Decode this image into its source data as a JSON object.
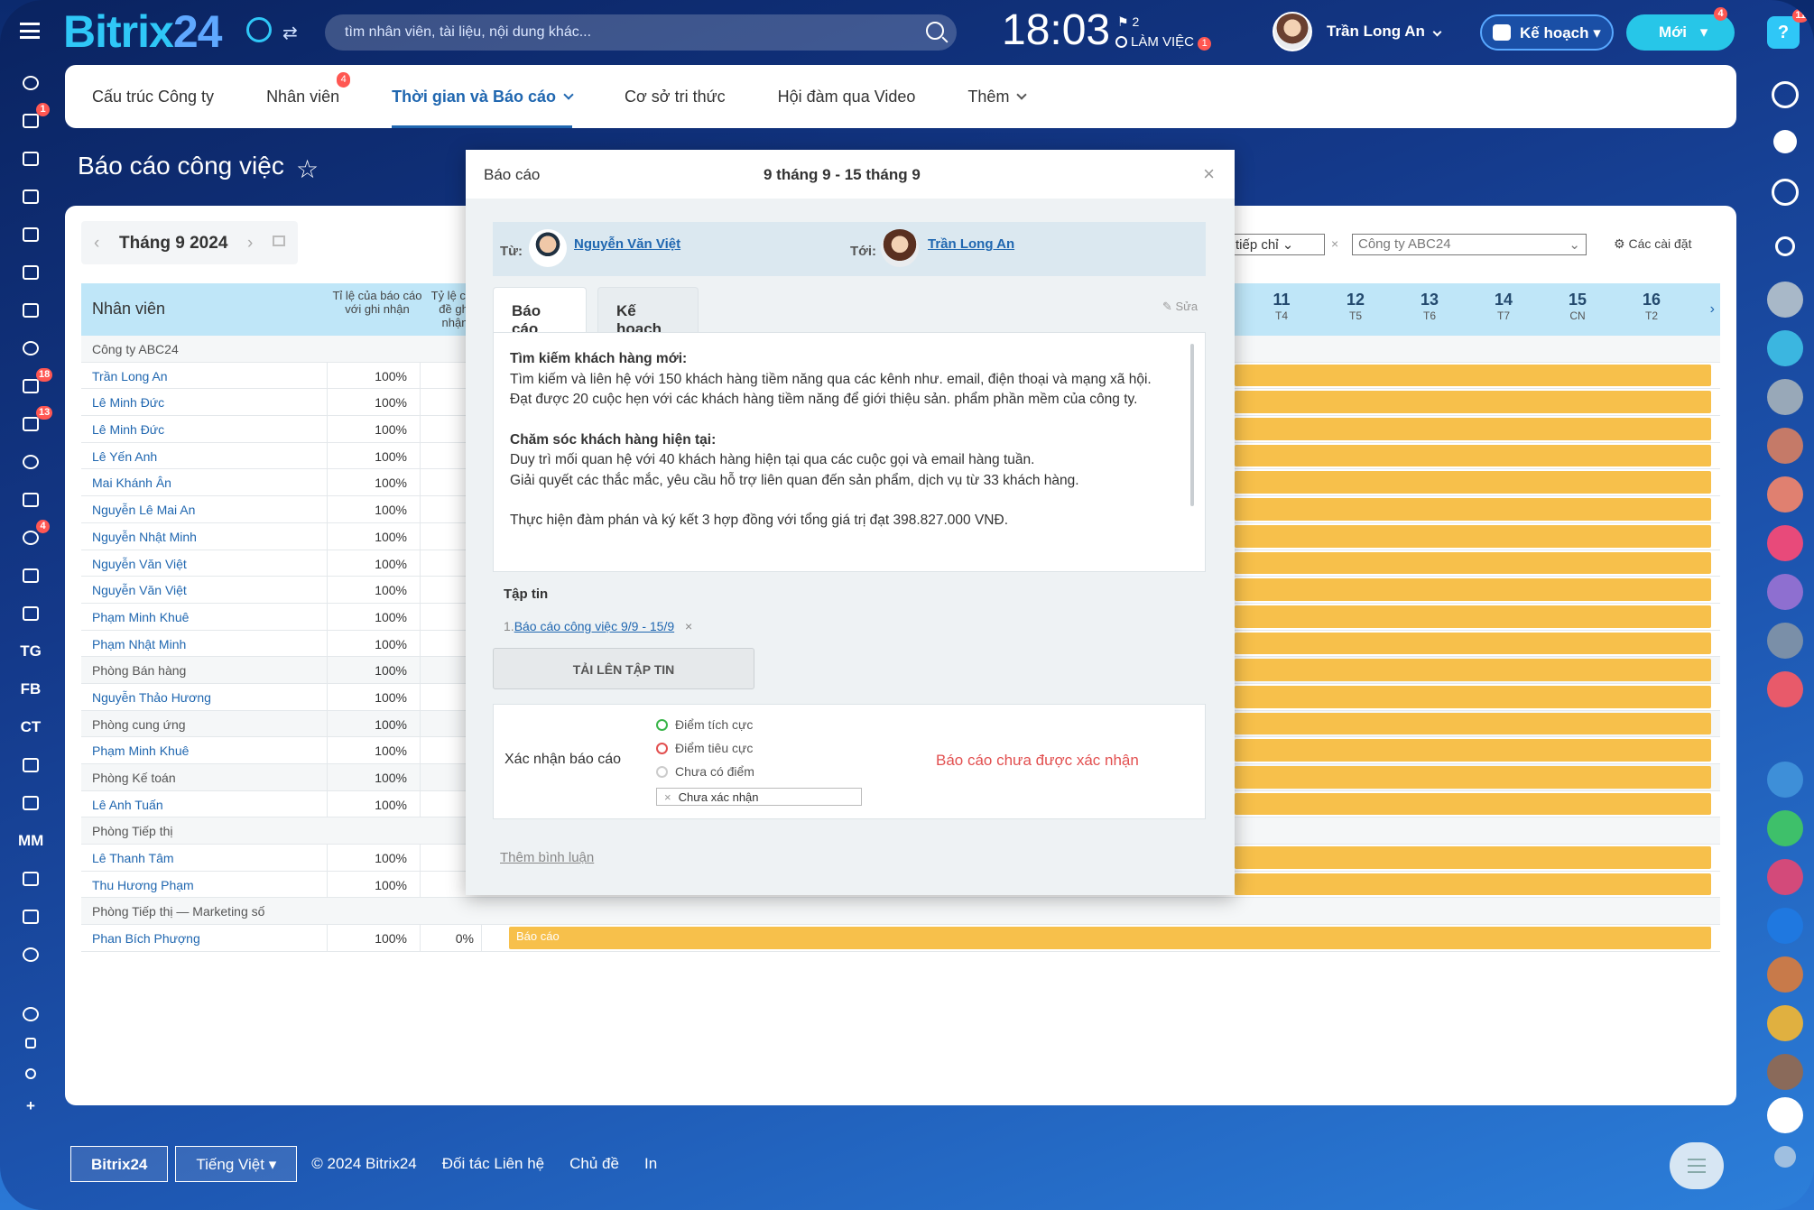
{
  "topbar": {
    "logo_a": "Bitrix",
    "logo_b": "24",
    "search_placeholder": "tìm nhân viên, tài liệu, nội dung khác...",
    "time": "18:03",
    "flag_count": "2",
    "work_status": "LÀM VIỆC",
    "work_badge": "1",
    "user_name": "Trần Long An",
    "plan_label": "Kế hoạch",
    "new_label": "Mới",
    "new_badge": "4",
    "help_badge": "11"
  },
  "left_rail": {
    "badges": {
      "tasks": "1",
      "todo": "18",
      "filter": "13",
      "contacts": "4"
    },
    "text_items": [
      "TG",
      "FB",
      "CT",
      "MM"
    ]
  },
  "nav": {
    "items": [
      {
        "label": "Cấu trúc Công ty"
      },
      {
        "label": "Nhân viên",
        "badge": "4"
      },
      {
        "label": "Thời gian và Báo cáo",
        "active": true
      },
      {
        "label": "Cơ sở tri thức"
      },
      {
        "label": "Hội đàm qua Video"
      },
      {
        "label": "Thêm"
      }
    ]
  },
  "page": {
    "title": "Báo cáo công việc",
    "month": "Tháng 9 2024"
  },
  "filters": {
    "f1": "tiếp chỉ",
    "f2": "Công ty ABC24",
    "settings": "Các cài đặt"
  },
  "grid": {
    "col_name": "Nhân viên",
    "col_ratio": "Tỉ lệ của báo cáo với ghi nhận",
    "col_ratio2": "Tỷ lệ chủ đề ghi nhận",
    "days": [
      {
        "d": "11",
        "w": "T4"
      },
      {
        "d": "12",
        "w": "T5"
      },
      {
        "d": "13",
        "w": "T6"
      },
      {
        "d": "14",
        "w": "T7"
      },
      {
        "d": "15",
        "w": "CN"
      },
      {
        "d": "16",
        "w": "T2"
      }
    ],
    "rows": [
      {
        "name": "Công ty ABC24",
        "group": true
      },
      {
        "name": "Trần Long An",
        "pct": "100%",
        "bar": true
      },
      {
        "name": "Lê Minh Đức",
        "pct": "100%",
        "bar": true
      },
      {
        "name": "Lê Minh Đức",
        "pct": "100%",
        "bar": true
      },
      {
        "name": "Lê Yến Anh",
        "pct": "100%",
        "bar": true
      },
      {
        "name": "Mai Khánh Ân",
        "pct": "100%",
        "bar": true
      },
      {
        "name": "Nguyễn Lê Mai An",
        "pct": "100%",
        "bar": true
      },
      {
        "name": "Nguyễn Nhật Minh",
        "pct": "100%",
        "bar": true
      },
      {
        "name": "Nguyễn Văn Việt",
        "pct": "100%",
        "bar": true
      },
      {
        "name": "Nguyễn Văn Việt",
        "pct": "100%",
        "bar": true
      },
      {
        "name": "Phạm Minh Khuê",
        "pct": "100%",
        "bar": true
      },
      {
        "name": "Phạm Nhật Minh",
        "pct": "100%",
        "bar": true
      },
      {
        "name": "Phòng Bán hàng",
        "group": true,
        "pct": "100%",
        "bar": true
      },
      {
        "name": "Nguyễn Thảo Hương",
        "pct": "100%",
        "bar": true
      },
      {
        "name": "Phòng cung ứng",
        "group": true,
        "pct": "100%",
        "bar": true
      },
      {
        "name": "Phạm Minh Khuê",
        "pct": "100%",
        "bar": true
      },
      {
        "name": "Phòng Kế toán",
        "group": true,
        "pct": "100%",
        "bar": true
      },
      {
        "name": "Lê Anh Tuấn",
        "pct": "100%",
        "bar": true
      },
      {
        "name": "Phòng Tiếp thị",
        "group": true
      },
      {
        "name": "Lê Thanh Tâm",
        "pct": "100%",
        "bar": true
      },
      {
        "name": "Thu Hương Phạm",
        "pct": "100%",
        "bar": true
      },
      {
        "name": "Phòng Tiếp thị — Marketing số",
        "group": true
      },
      {
        "name": "Phan Bích Phượng",
        "pct": "100%",
        "pct2": "0%",
        "bar": true,
        "full": true,
        "bar_label": "Báo cáo"
      }
    ]
  },
  "modal": {
    "title": "Báo cáo",
    "dates": "9 tháng 9 - 15 tháng 9",
    "from_label": "Từ:",
    "from_name": "Nguyễn Văn Việt",
    "to_label": "Tới:",
    "to_name": "Trần Long An",
    "tab_report": "Báo cáo",
    "tab_plan": "Kế hoạch",
    "edit": "Sửa",
    "content": {
      "h1": "Tìm kiếm khách hàng mới:",
      "p1": "Tìm kiếm và liên hệ với 150 khách hàng tiềm năng qua các kênh như. email, điện thoại và mạng xã hội.",
      "p2": "Đạt được 20 cuộc hẹn với các khách hàng tiềm năng để giới thiệu sản. phẩm phần mềm của công ty.",
      "h2": "Chăm sóc khách hàng hiện tại:",
      "p3": "Duy trì mối quan hệ với 40 khách hàng hiện tại qua các cuộc gọi và email hàng tuần.",
      "p4": "Giải quyết các thắc mắc, yêu cầu hỗ trợ liên quan đến sản phẩm, dịch vụ từ 33 khách hàng.",
      "p5": "Thực hiện đàm phán và ký kết 3 hợp đồng với tổng giá trị đạt 398.827.000 VNĐ."
    },
    "files_title": "Tập tin",
    "file_index": "1.",
    "file_name": "Báo cáo công việc 9/9 - 15/9",
    "upload": "TẢI LÊN TẬP TIN",
    "confirm_label": "Xác nhận báo cáo",
    "opt_pos": "Điểm tích cực",
    "opt_neg": "Điểm tiêu cực",
    "opt_none": "Chưa có điểm",
    "select_value": "Chưa xác nhận",
    "status": "Báo cáo chưa được xác nhận",
    "add_comment": "Thêm bình luận"
  },
  "footer": {
    "brand": "Bitrix24",
    "lang": "Tiếng Việt",
    "copy": "© 2024 Bitrix24",
    "partner": "Đối tác Liên hệ",
    "theme": "Chủ đề",
    "print": "In"
  },
  "colors": {
    "accent": "#2067b0",
    "bar": "#f7c04b",
    "header": "#bfe6f8",
    "status_red": "#e25050"
  }
}
